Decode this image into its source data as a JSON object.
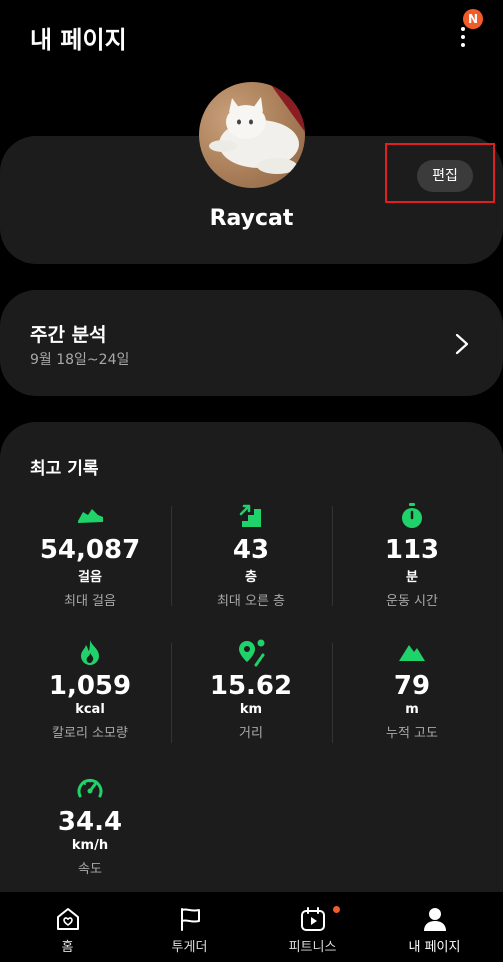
{
  "header": {
    "title": "내 페이지",
    "notification_badge": "N"
  },
  "profile": {
    "name": "Raycat",
    "edit_label": "편집"
  },
  "weekly": {
    "title": "주간 분석",
    "range": "9월 18일~24일"
  },
  "records": {
    "title": "최고 기록",
    "items": [
      {
        "icon": "shoe-icon",
        "value": "54,087",
        "unit": "걸음",
        "label": "최대 걸음"
      },
      {
        "icon": "stairs-icon",
        "value": "43",
        "unit": "층",
        "label": "최대 오른 층"
      },
      {
        "icon": "stopwatch-icon",
        "value": "113",
        "unit": "분",
        "label": "운동 시간"
      },
      {
        "icon": "flame-icon",
        "value": "1,059",
        "unit": "kcal",
        "label": "칼로리 소모량"
      },
      {
        "icon": "route-pin-icon",
        "value": "15.62",
        "unit": "km",
        "label": "거리"
      },
      {
        "icon": "mountain-icon",
        "value": "79",
        "unit": "m",
        "label": "누적 고도"
      },
      {
        "icon": "speedometer-icon",
        "value": "34.4",
        "unit": "km/h",
        "label": "속도"
      }
    ]
  },
  "nav": {
    "items": [
      {
        "label": "홈",
        "icon": "home-heart-icon"
      },
      {
        "label": "투게더",
        "icon": "flag-icon"
      },
      {
        "label": "피트니스",
        "icon": "fitness-play-icon"
      },
      {
        "label": "내 페이지",
        "icon": "person-icon"
      }
    ]
  },
  "colors": {
    "accent": "#1fd26a",
    "badge": "#f25c2a",
    "card": "#1c1c1c",
    "highlight": "#e02020"
  }
}
